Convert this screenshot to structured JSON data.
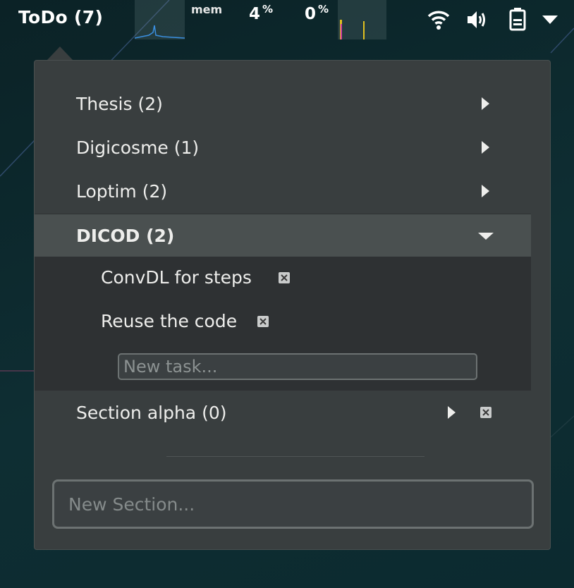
{
  "topbar": {
    "todo_label": "ToDo (7)",
    "mem_label": "mem",
    "mem_value": "4",
    "cpu_value": "0",
    "percent_sign": "%",
    "icons": [
      "wifi-icon",
      "volume-icon",
      "battery-icon",
      "caret-down-icon"
    ]
  },
  "sections": [
    {
      "label": "Thesis (2)"
    },
    {
      "label": "Digicosme (1)"
    },
    {
      "label": "Loptim (2)"
    }
  ],
  "expanded_section": {
    "label": "DICOD (2)",
    "tasks": [
      {
        "label": "ConvDL for steps"
      },
      {
        "label": "Reuse the code"
      }
    ],
    "new_task_placeholder": "New task..."
  },
  "extra_section": {
    "label": "Section alpha (0)"
  },
  "new_section_placeholder": "New Section...",
  "colors": {
    "popup_bg": "#393e3f",
    "expanded_header_bg": "#4a5050",
    "expanded_body_bg": "#2e3133",
    "text": "#eeeeec",
    "desktop_bg": "#0d2a2e"
  }
}
